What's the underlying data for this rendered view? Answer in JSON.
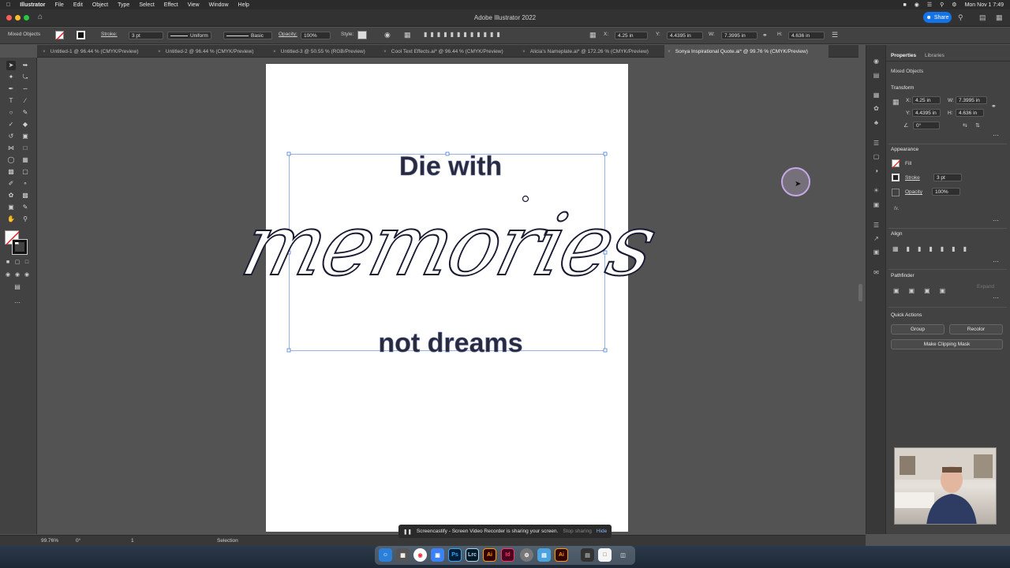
{
  "menubar": {
    "app": "Illustrator",
    "items": [
      "File",
      "Edit",
      "Object",
      "Type",
      "Select",
      "Effect",
      "View",
      "Window",
      "Help"
    ],
    "clock": "Mon Nov 1  7:49"
  },
  "window": {
    "title": "Adobe Illustrator 2022",
    "share_label": "Share"
  },
  "controlbar": {
    "selection_type": "Mixed Objects",
    "stroke_label": "Stroke:",
    "stroke_value": "3 pt",
    "profile_uniform": "Uniform",
    "brush_basic": "Basic",
    "opacity_label": "Opacity:",
    "opacity_value": "100%",
    "style_label": "Style:",
    "x_label": "X:",
    "x_value": "4.25 in",
    "y_label": "Y:",
    "y_value": "4.4395 in",
    "w_label": "W:",
    "w_value": "7.3995 in",
    "h_label": "H:",
    "h_value": "4.636 in"
  },
  "tabs": [
    {
      "label": "Untitled-1 @ 96.44 % (CMYK/Preview)"
    },
    {
      "label": "Untitled-2 @ 96.44 % (CMYK/Preview)"
    },
    {
      "label": "Untitled-3 @ 50.55 % (RGB/Preview)"
    },
    {
      "label": "Cool Text Effects.ai* @ 96.44 % (CMYK/Preview)"
    },
    {
      "label": "Alicia's Nameplate.ai* @ 172.26 % (CMYK/Preview)"
    },
    {
      "label": "Sonya Inspirational Quote.ai* @ 99.76 % (CMYK/Preview)"
    }
  ],
  "artwork": {
    "line1": "Die with",
    "line2": "memories",
    "line3": "not dreams"
  },
  "panel": {
    "tab_properties": "Properties",
    "tab_libraries": "Libraries",
    "selection_type": "Mixed Objects",
    "transform_title": "Transform",
    "x_label": "X:",
    "x_value": "4.25 in",
    "y_label": "Y:",
    "y_value": "4.4395 in",
    "w_label": "W:",
    "w_value": "7.3995 in",
    "h_label": "H:",
    "h_value": "4.636 in",
    "rotate_value": "0°",
    "appearance_title": "Appearance",
    "fill_label": "Fill",
    "stroke_label": "Stroke",
    "stroke_value": "3 pt",
    "opacity_label": "Opacity",
    "opacity_value": "100%",
    "fx_label": "fx.",
    "align_title": "Align",
    "pathfinder_title": "Pathfinder",
    "expand_label": "Expand",
    "quick_actions_title": "Quick Actions",
    "group_label": "Group",
    "recolor_label": "Recolor",
    "clipping_mask_label": "Make Clipping Mask"
  },
  "statusbar": {
    "zoom": "99.76%",
    "rotation": "0°",
    "artboard_num": "1",
    "tool_name": "Selection"
  },
  "screencastify": {
    "message": "Screencastify - Screen Video Recorder is sharing your screen.",
    "stop_label": "Stop sharing",
    "hide_label": "Hide"
  },
  "dock_apps": [
    {
      "label": "Ps",
      "color": "#31a8ff",
      "bg": "#001e36"
    },
    {
      "label": "Lrc",
      "color": "#add5ec",
      "bg": "#001a2a"
    },
    {
      "label": "Ai",
      "color": "#ff9a00",
      "bg": "#330000"
    },
    {
      "label": "Id",
      "color": "#ff3366",
      "bg": "#49021f"
    },
    {
      "label": "Ai",
      "color": "#ff9a00",
      "bg": "#330000"
    }
  ],
  "colors": {
    "accent": "#1473e6",
    "selection_bbox": "#4a7fd4",
    "art_stroke": "#1a1a33"
  }
}
